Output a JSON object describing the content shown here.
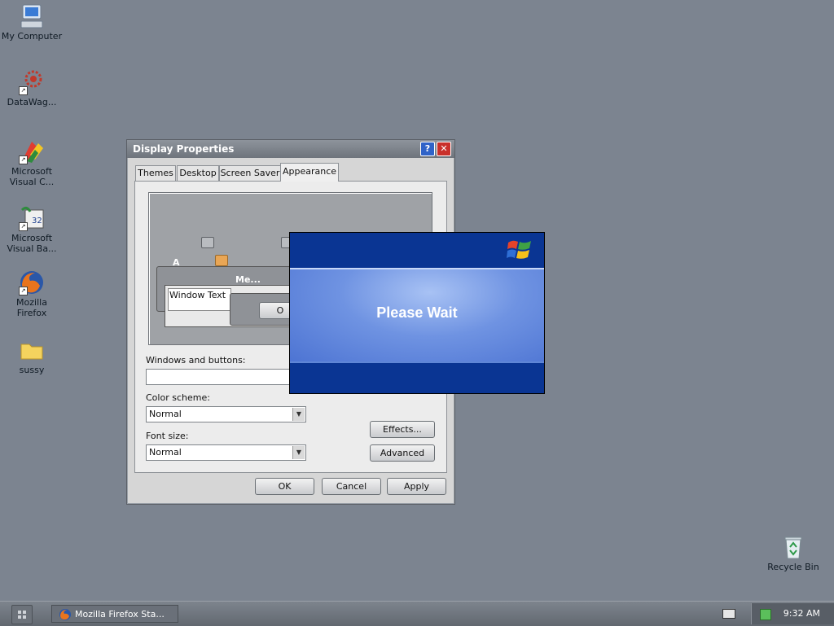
{
  "desktop": {
    "icons": [
      {
        "label": "My Computer",
        "icon": "my-computer-icon"
      },
      {
        "label": "DataWag...",
        "icon": "datawag-icon",
        "shortcut": true
      },
      {
        "label": "Microsoft Visual C...",
        "icon": "visual-c-icon",
        "shortcut": true
      },
      {
        "label": "Microsoft Visual Ba...",
        "icon": "visual-basic-icon",
        "shortcut": true
      },
      {
        "label": "Mozilla Firefox",
        "icon": "firefox-icon",
        "shortcut": true
      },
      {
        "label": "sussy",
        "icon": "folder-icon"
      },
      {
        "label": "Recycle Bin",
        "icon": "recycle-bin-icon"
      }
    ]
  },
  "window": {
    "title": "Display Properties",
    "tabs": [
      "Themes",
      "Desktop",
      "Screen Saver",
      "Appearance"
    ],
    "active_tab": "Appearance",
    "preview": {
      "inactive_label": "A",
      "active_title": "Me...",
      "window_text": "Window Text",
      "ok_fragment": "O"
    },
    "windows_and_buttons_label": "Windows and buttons:",
    "windows_and_buttons_value": "",
    "color_scheme_label": "Color scheme:",
    "color_scheme_value": "Normal",
    "font_size_label": "Font size:",
    "font_size_value": "Normal",
    "effects_button": "Effects...",
    "advanced_button": "Advanced",
    "ok_button": "OK",
    "cancel_button": "Cancel",
    "apply_button": "Apply"
  },
  "splash": {
    "message": "Please Wait"
  },
  "taskbar": {
    "task_label": "Mozilla Firefox Sta...",
    "clock": "9:32 AM"
  },
  "colors": {
    "desktop": "#7c8490",
    "splash_dark": "#0a3593",
    "splash_light": "#6f93e2"
  }
}
